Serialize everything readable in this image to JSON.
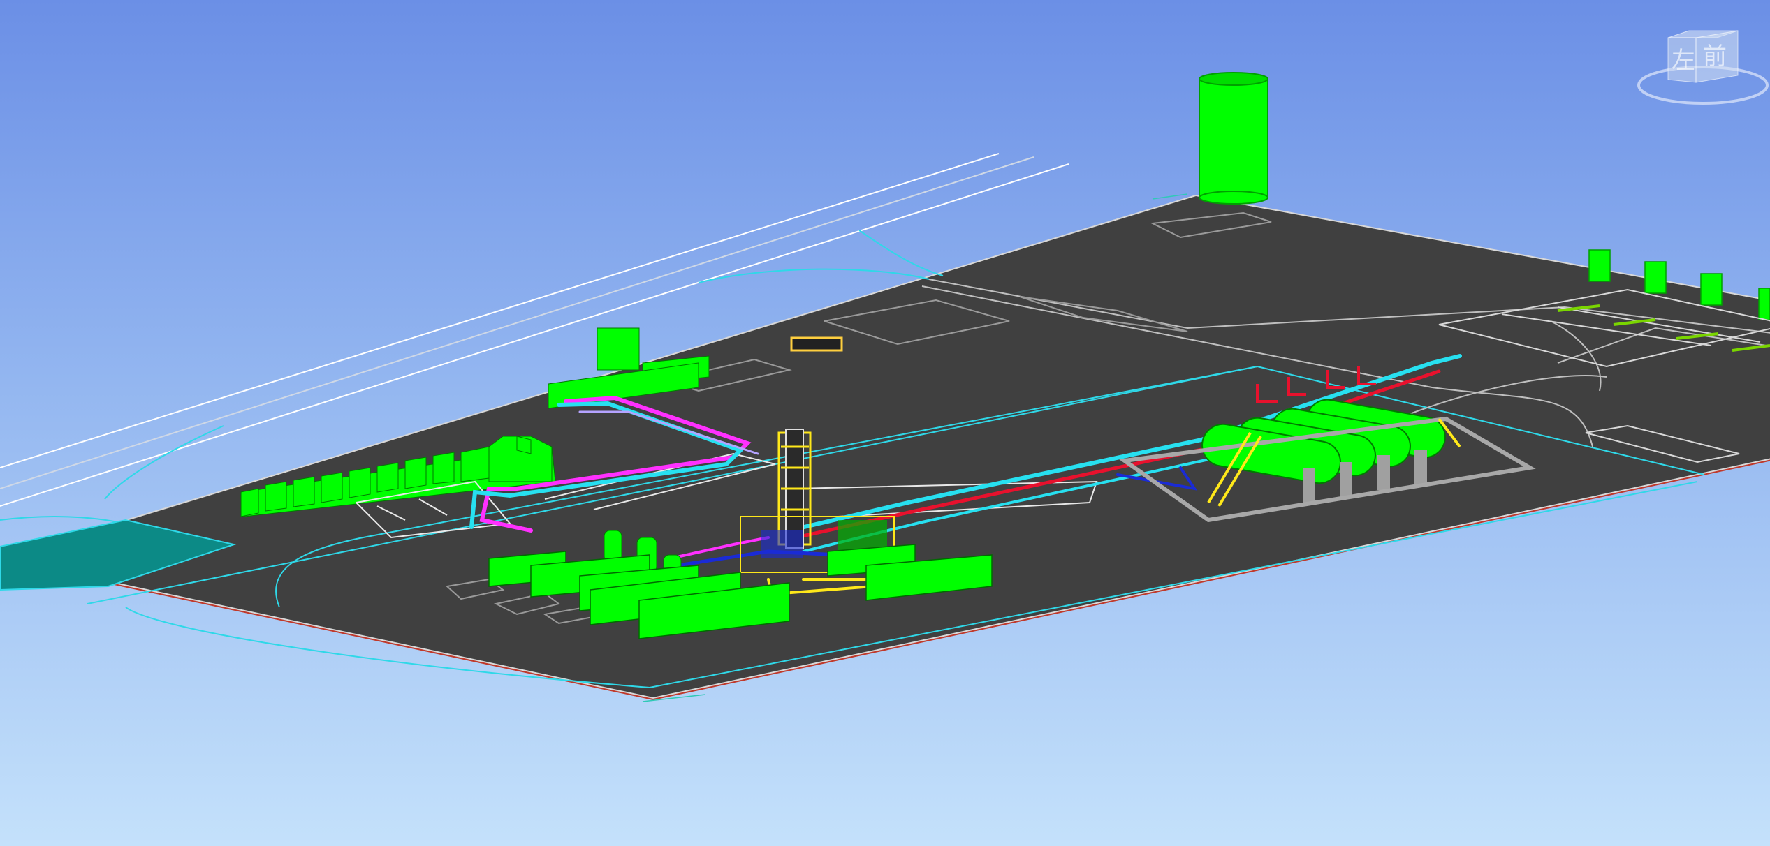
{
  "view_cube": {
    "left_face_label": "左",
    "front_face_label": "前"
  },
  "colors": {
    "sky_top": "#6b8fe6",
    "sky_bottom": "#c4e1fb",
    "ground": "#404040",
    "equipment": "#00ff00",
    "boundary_outline": "#00e5e5",
    "pipe_cyan": "#27e0f0",
    "pipe_magenta": "#ff30ff",
    "pipe_red": "#e8112d",
    "pipe_blue": "#1a2bd6",
    "pipe_yellow": "#ffe81a",
    "basin": "#0c8a86"
  },
  "icons": {
    "view_cube": "view-cube-icon"
  }
}
